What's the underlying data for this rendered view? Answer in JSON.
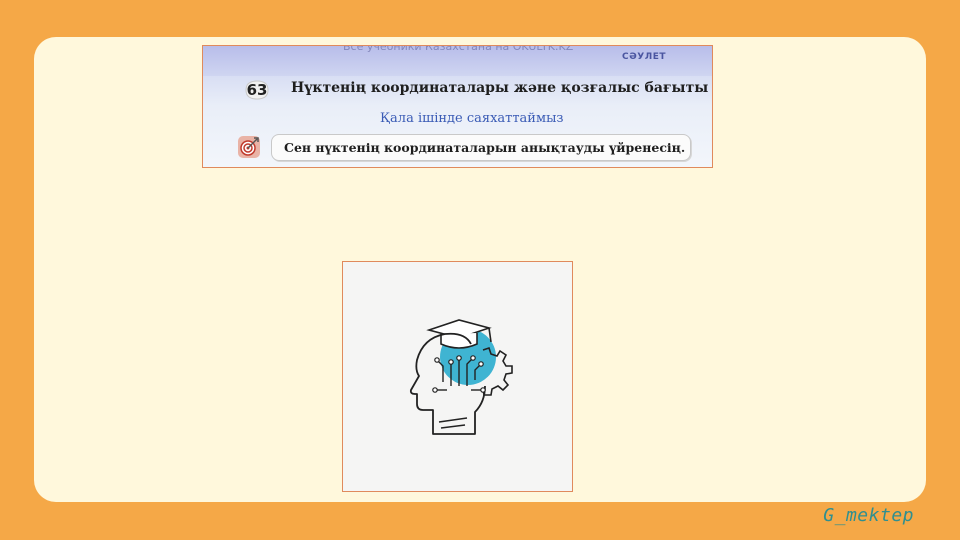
{
  "banner": {
    "faded_header": "Все учебники Казахстана на OKULYK.KZ",
    "section_tag": "СӘУЛЕТ",
    "lesson_number": "63",
    "lesson_title": "Нүктенің координаталары және қозғалыс бағыты",
    "subtitle": "Қала ішінде саяхаттаймыз",
    "goal_text": "Сен нүктенің координаталарын анықтауды үйренесің.",
    "goal_icon": "target-icon"
  },
  "illustration": {
    "icon": "head-circuit-gear-icon",
    "accent_color": "#3fb4d2"
  },
  "logo": {
    "text": "G_mektep",
    "color": "#2f8f8f"
  },
  "colors": {
    "background": "#f5a847",
    "card": "#fff8dc",
    "banner_border": "#e08a5c"
  }
}
